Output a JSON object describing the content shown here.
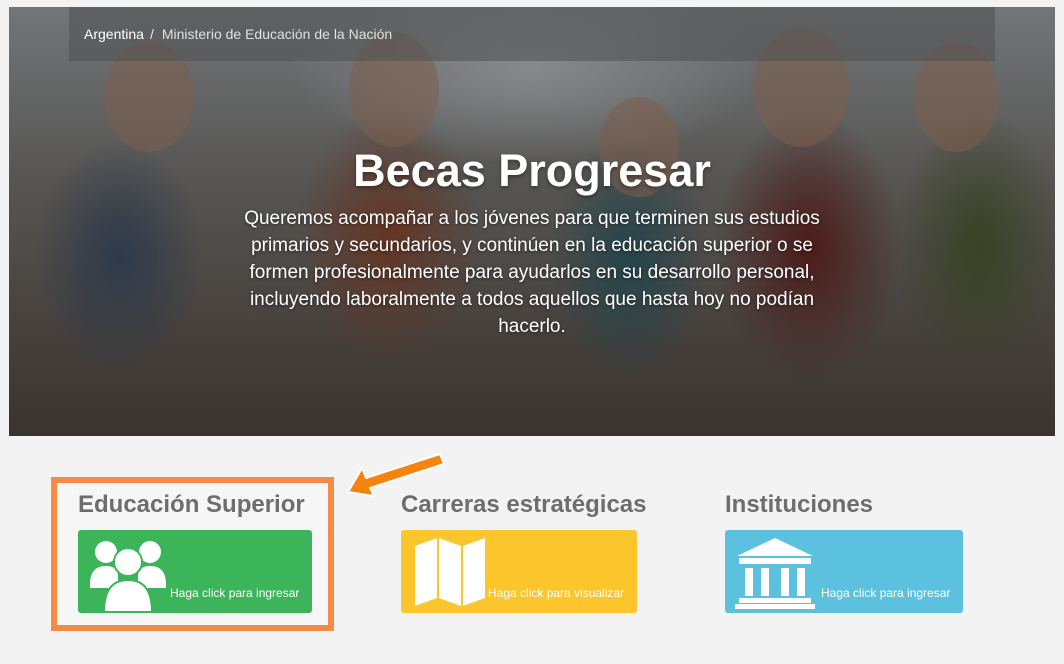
{
  "breadcrumb": {
    "home": "Argentina",
    "separator": "/",
    "current": "Ministerio de Educación de la Nación"
  },
  "hero": {
    "title": "Becas Progresar",
    "description": "Queremos acompañar a los jóvenes para que terminen sus estudios primarios y secundarios, y continúen en la educación superior o se formen profesionalmente para ayudarlos en su desarrollo personal, incluyendo laboralmente a todos aquellos que hasta hoy no podían hacerlo."
  },
  "cards": [
    {
      "title": "Educación Superior",
      "button_label": "Haga click para ingresar",
      "icon": "users-group-icon",
      "color": "#3cb55a"
    },
    {
      "title": "Carreras estratégicas",
      "button_label": "Haga click para visualizar",
      "icon": "map-icon",
      "color": "#fbc52c"
    },
    {
      "title": "Instituciones",
      "button_label": "Haga click para ingresar",
      "icon": "institution-building-icon",
      "color": "#5bc1df"
    }
  ],
  "colors": {
    "highlight_border": "#f58b47",
    "arrow": "#f7830f",
    "card_title": "#6d6d6d"
  }
}
